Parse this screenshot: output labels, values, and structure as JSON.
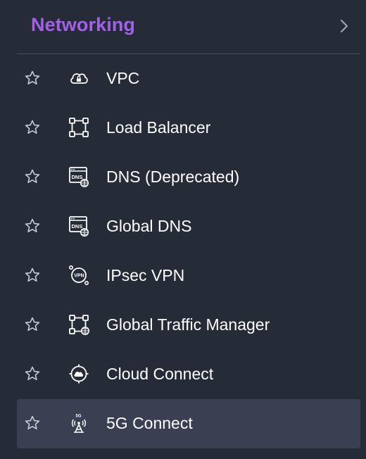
{
  "section": {
    "title": "Networking",
    "title_color": "#a361e8",
    "chevron_icon": "chevron-right-icon"
  },
  "items": [
    {
      "label": "VPC",
      "icon": "cloud-lock-icon",
      "favorite": false,
      "active": false
    },
    {
      "label": "Load Balancer",
      "icon": "load-balancer-icon",
      "favorite": false,
      "active": false
    },
    {
      "label": "DNS (Deprecated)",
      "icon": "dns-icon",
      "favorite": false,
      "active": false
    },
    {
      "label": "Global DNS",
      "icon": "dns-icon",
      "favorite": false,
      "active": false
    },
    {
      "label": "IPsec VPN",
      "icon": "vpn-icon",
      "favorite": false,
      "active": false
    },
    {
      "label": "Global Traffic Manager",
      "icon": "traffic-manager-icon",
      "favorite": false,
      "active": false
    },
    {
      "label": "Cloud Connect",
      "icon": "cloud-connect-icon",
      "favorite": false,
      "active": false
    },
    {
      "label": "5G Connect",
      "icon": "5g-tower-icon",
      "favorite": false,
      "active": true
    }
  ],
  "icon_text": {
    "dns": "DNS",
    "vpn": "VPN",
    "fiveg": "5G"
  },
  "colors": {
    "background": "#262b38",
    "active_row": "#3a3f52",
    "divider": "#4b5060",
    "icon": "#ffffff",
    "star": "#c8cbd4"
  }
}
